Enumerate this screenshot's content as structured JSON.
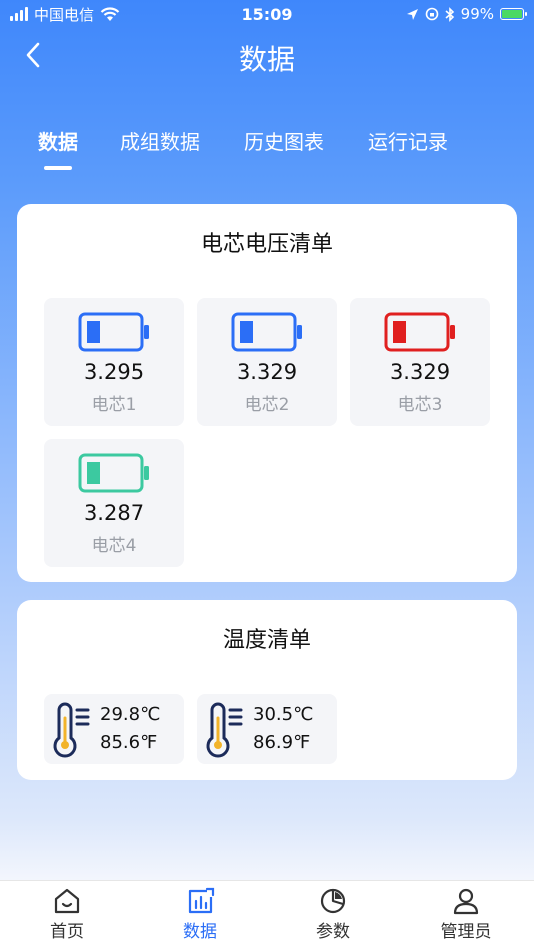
{
  "status": {
    "carrier": "中国电信",
    "time": "15:09",
    "battery_percent": "99%",
    "battery_level": 0.99
  },
  "nav": {
    "title": "数据"
  },
  "tabs": [
    {
      "label": "数据",
      "active": true
    },
    {
      "label": "成组数据",
      "active": false
    },
    {
      "label": "历史图表",
      "active": false
    },
    {
      "label": "运行记录",
      "active": false
    }
  ],
  "voltage": {
    "title": "电芯电压清单",
    "cells": [
      {
        "value": "3.295",
        "label": "电芯1",
        "color": "#2b6ef6"
      },
      {
        "value": "3.329",
        "label": "电芯2",
        "color": "#2b6ef6"
      },
      {
        "value": "3.329",
        "label": "电芯3",
        "color": "#e02020"
      },
      {
        "value": "3.287",
        "label": "电芯4",
        "color": "#3cc9a0"
      }
    ]
  },
  "temperature": {
    "title": "温度清单",
    "items": [
      {
        "celsius": "29.8℃",
        "fahrenheit": "85.6℉"
      },
      {
        "celsius": "30.5℃",
        "fahrenheit": "86.9℉"
      }
    ]
  },
  "bottom_nav": [
    {
      "label": "首页",
      "icon": "home-icon",
      "active": false
    },
    {
      "label": "数据",
      "icon": "chart-icon",
      "active": true
    },
    {
      "label": "参数",
      "icon": "pie-icon",
      "active": false
    },
    {
      "label": "管理员",
      "icon": "user-icon",
      "active": false
    }
  ],
  "colors": {
    "accent": "#2b6ef6",
    "thermo_body": "#1c2b5a",
    "thermo_mercury": "#f2b32a"
  }
}
